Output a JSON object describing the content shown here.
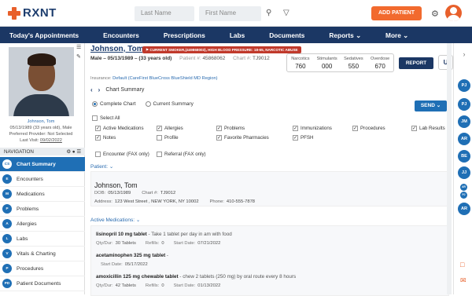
{
  "brand": {
    "name": "RXNT"
  },
  "search": {
    "last_name_placeholder": "Last Name",
    "first_name_placeholder": "First Name"
  },
  "topbar": {
    "add_patient": "ADD PATIENT"
  },
  "nav": [
    "Today's Appointments",
    "Encounters",
    "Prescriptions",
    "Labs",
    "Documents",
    "Reports ⌄",
    "More ⌄"
  ],
  "patient": {
    "name": "Johnson, Tom",
    "alert": "CURRENT SMOKER,(449868003), HIGH BLOOD PRESSURE: 18-65, NARCOTIC ABUSE",
    "sex_dob": "Male – 05/13/1989 – (33 years old)",
    "patient_num_label": "Patient #:",
    "patient_num": "45868062",
    "chart_label": "Chart #:",
    "chart_num": "TJ9012",
    "photo_caption": "Johnson, Tom",
    "photo_line2": "05/13/1989 (33 years old), Male",
    "photo_line3": "Preferred Provider: Not Selected",
    "photo_line4_label": "Last Visit:",
    "photo_line4_value": "09/02/2022",
    "insurance_label": "Insurance:",
    "insurance_value": "Default (CareFirst BlueCross BlueShield MD Region)"
  },
  "stats": [
    {
      "label": "Narcotics",
      "value": "760"
    },
    {
      "label": "Stimulants",
      "value": "000"
    },
    {
      "label": "Sedatives",
      "value": "550"
    },
    {
      "label": "Overdose",
      "value": "670"
    }
  ],
  "report_btn": "REPORT",
  "u_btn": "U",
  "navigation": {
    "header": "NAVIGATION",
    "items": [
      {
        "code": "CS",
        "label": "Chart Summary",
        "active": true
      },
      {
        "code": "E",
        "label": "Encounters"
      },
      {
        "code": "M",
        "label": "Medications"
      },
      {
        "code": "P",
        "label": "Problems"
      },
      {
        "code": "A",
        "label": "Allergies"
      },
      {
        "code": "L",
        "label": "Labs"
      },
      {
        "code": "V",
        "label": "Vitals & Charting"
      },
      {
        "code": "P",
        "label": "Procedures"
      },
      {
        "code": "PD",
        "label": "Patient Documents"
      }
    ]
  },
  "chart_summary": {
    "title": "Chart Summary",
    "radio_complete": "Complete Chart",
    "radio_current": "Current Summary",
    "send": "SEND ⌄",
    "select_all": "Select All",
    "checks": [
      {
        "label": "Active Medications",
        "checked": true
      },
      {
        "label": "Allergies",
        "checked": true
      },
      {
        "label": "Problems",
        "checked": true
      },
      {
        "label": "Immunizations",
        "checked": true
      },
      {
        "label": "Procedures",
        "checked": true
      },
      {
        "label": "Lab Results",
        "checked": true
      },
      {
        "label": "Notes",
        "checked": true
      },
      {
        "label": "Profile",
        "checked": false
      },
      {
        "label": "Favorite Pharmacies",
        "checked": true
      },
      {
        "label": "PFSH",
        "checked": true
      }
    ],
    "encounter_fax": "Encounter (FAX only)",
    "referral_fax": "Referral (FAX only)"
  },
  "patient_section": {
    "title": "Patient:",
    "name": "Johnson, Tom",
    "dob_label": "DOB:",
    "dob": "05/13/1989",
    "chart_label": "Chart #:",
    "chart": "TJ9012",
    "address_label": "Address:",
    "address": "123 West Street , NEW YORK, NY 10002",
    "phone_label": "Phone:",
    "phone": "410-555-7878"
  },
  "meds_section": {
    "title": "Active Medications:",
    "meds": [
      {
        "name": "lisinopril 10 mg tablet",
        "desc": " - Take 1 tablet per day in am with food",
        "qty_label": "Qty/Dur:",
        "qty": "30 Tablets",
        "refills_label": "Refills:",
        "refills": "0",
        "start_label": "Start Date:",
        "start": "07/21/2022"
      },
      {
        "name": "acetaminophen 325 mg tablet",
        "desc": " -",
        "start_label": "Start Date:",
        "start": "05/17/2022"
      },
      {
        "name": "amoxicillin 125 mg chewable tablet",
        "desc": " - chew 2 tablets (250 mg) by oral route every 8 hours",
        "qty_label": "Qty/Dur:",
        "qty": "42 Tablets",
        "refills_label": "Refills:",
        "refills": "0",
        "start_label": "Start Date:",
        "start": "01/13/2022"
      }
    ]
  },
  "right_rail": [
    "PJ",
    "PJ",
    "JM",
    "AR",
    "BE",
    "JJ",
    "AR",
    "PJ",
    "AR"
  ]
}
